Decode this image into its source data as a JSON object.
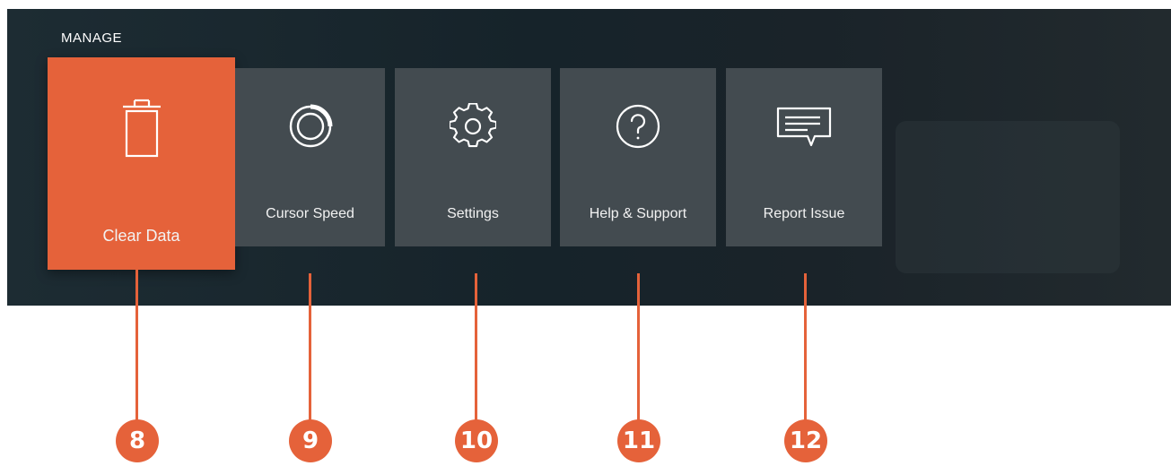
{
  "header": {
    "section_title": "MANAGE"
  },
  "tiles": [
    {
      "label": "Clear Data",
      "icon": "trash-icon"
    },
    {
      "label": "Cursor Speed",
      "icon": "speed-dial-icon"
    },
    {
      "label": "Settings",
      "icon": "gear-icon"
    },
    {
      "label": "Help & Support",
      "icon": "help-icon"
    },
    {
      "label": "Report Issue",
      "icon": "message-icon"
    }
  ],
  "callouts": [
    "8",
    "9",
    "10",
    "11",
    "12"
  ],
  "colors": {
    "accent": "#e5623a",
    "tile": "#434b50",
    "background": "#1a2a30"
  }
}
